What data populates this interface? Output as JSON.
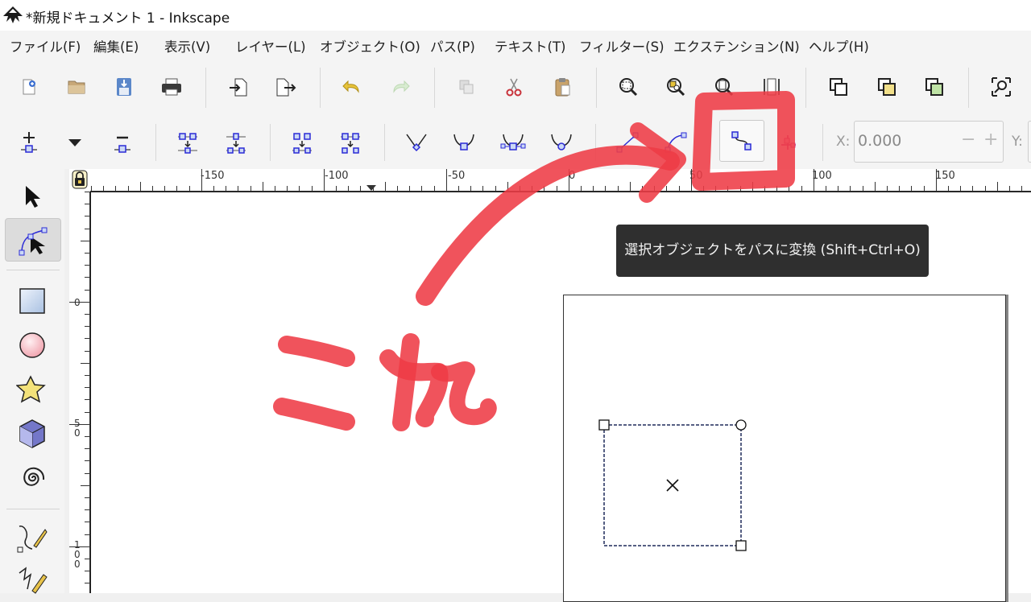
{
  "window": {
    "title": "*新規ドキュメント 1 - Inkscape"
  },
  "menu": [
    "ファイル(F)",
    "編集(E)",
    "表示(V)",
    "レイヤー(L)",
    "オブジェクト(O)",
    "パス(P)",
    "テキスト(T)",
    "フィルター(S)",
    "エクステンション(N)",
    "ヘルプ(H)"
  ],
  "coords": {
    "x_label": "X:",
    "x_value": "0.000",
    "minus": "−",
    "plus": "+",
    "y_label": "Y:"
  },
  "ruler": {
    "top": [
      "-150",
      "-100",
      "-50",
      "0",
      "50",
      "100",
      "150"
    ],
    "left": [
      "0",
      "5\n0",
      "1\n0\n0"
    ]
  },
  "tooltip": "選択オブジェクトをパスに変換 (Shift+Ctrl+O)",
  "annotation": {
    "text": "これ",
    "color": "#ee3b46"
  },
  "colors": {
    "node_blue": "#2b2bd6",
    "accent_red": "#ee3b46"
  }
}
